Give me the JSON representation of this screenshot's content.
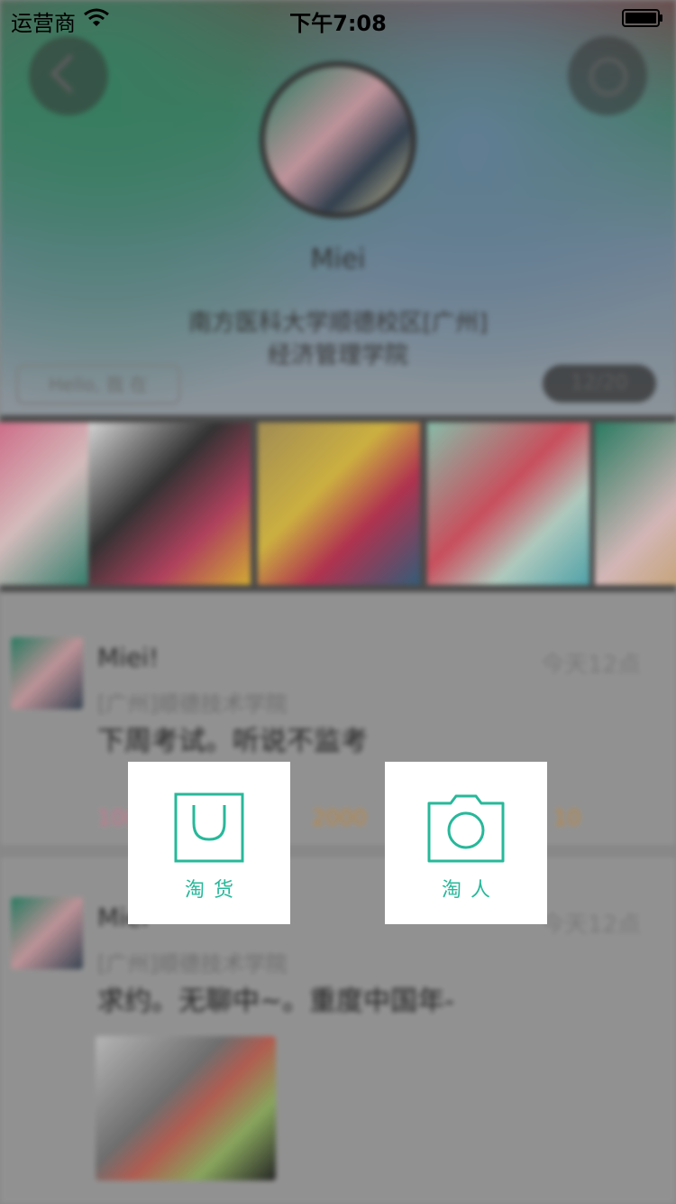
{
  "status_bar": {
    "carrier": "运营商",
    "time": "下午7:08"
  },
  "profile": {
    "name": "Miei",
    "school_line1": "南方医科大学顺德校区[广州]",
    "school_line2": "经济管理学院",
    "tag": "Hello, 我 在",
    "counter": "12/20"
  },
  "posts": [
    {
      "name": "Miei!",
      "time": "今天12点",
      "school": "[广州]顺德技术学院",
      "text": "下周考试。听说不监考",
      "stats": [
        "100",
        "2000",
        "10"
      ]
    },
    {
      "name": "Miei",
      "time": "今天12点",
      "school": "[广州]顺德技术学院",
      "text": "求约。无聊中~。重度中国年-"
    }
  ],
  "actions": [
    {
      "label": "淘货",
      "icon": "shopping-bag-icon"
    },
    {
      "label": "淘人",
      "icon": "camera-icon"
    }
  ],
  "colors": {
    "accent": "#27b89a",
    "stat_pink": "#e58aa5",
    "stat_orange": "#d89a4a"
  }
}
